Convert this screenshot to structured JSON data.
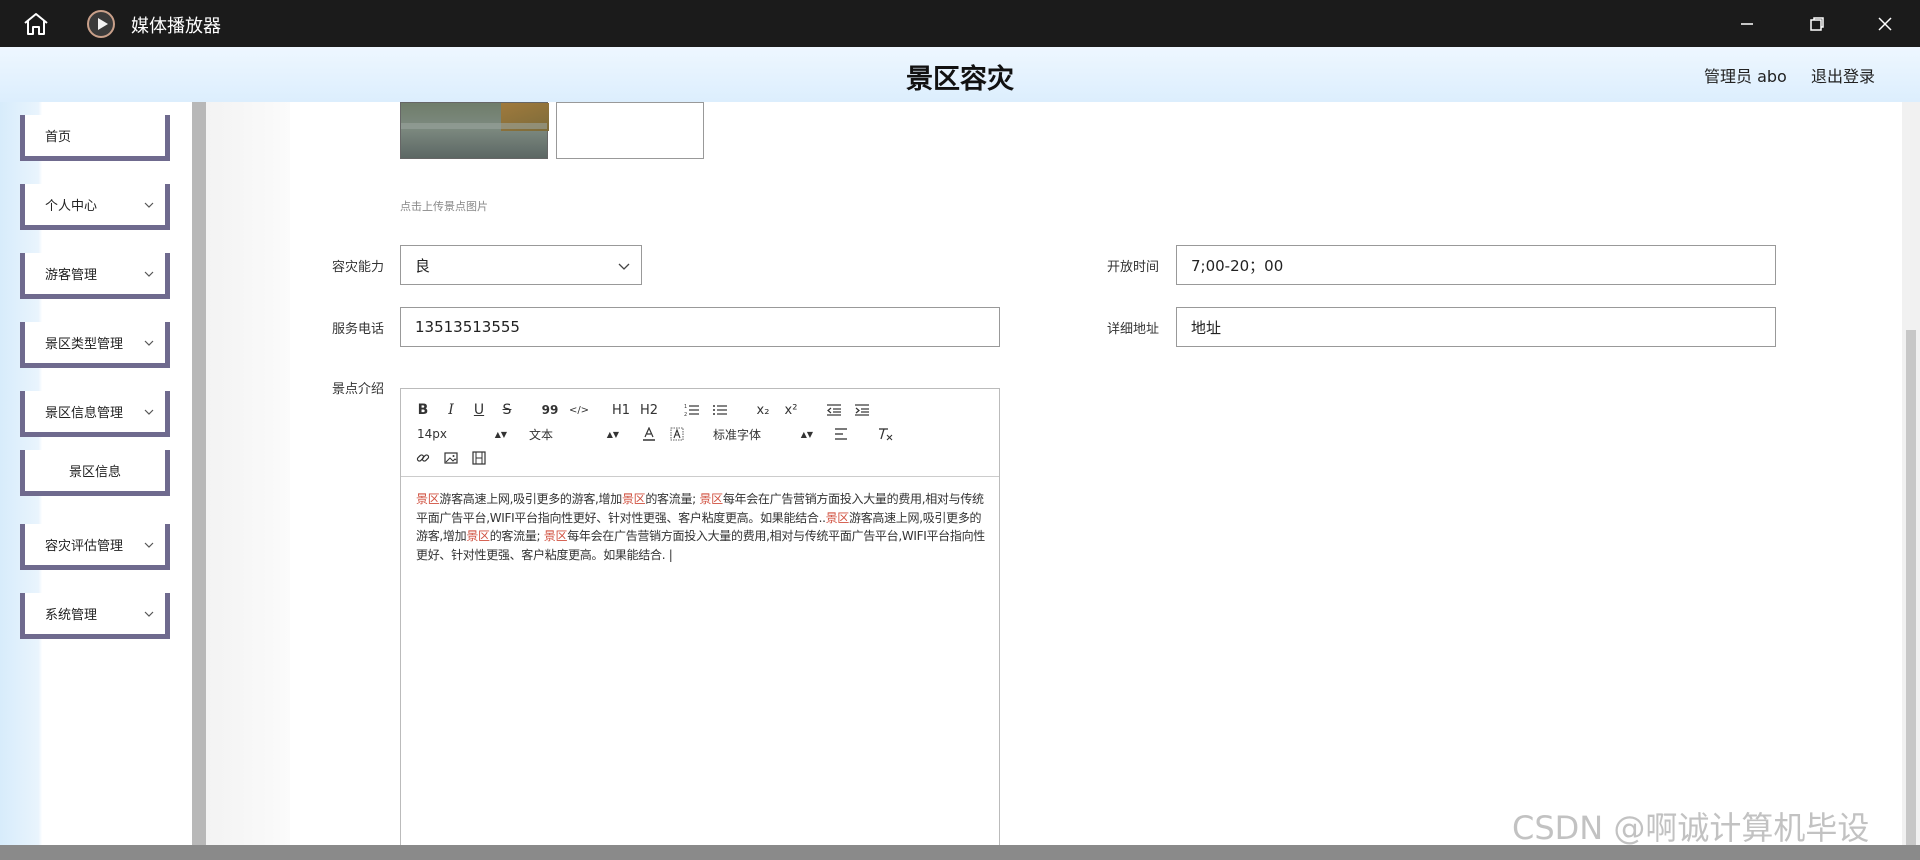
{
  "window": {
    "title": "媒体播放器"
  },
  "header": {
    "title": "景区容灾",
    "user": "管理员 abo",
    "logout": "退出登录"
  },
  "sidebar": {
    "items": [
      {
        "label": "首页"
      },
      {
        "label": "个人中心"
      },
      {
        "label": "游客管理"
      },
      {
        "label": "景区类型管理"
      },
      {
        "label": "景区信息管理"
      },
      {
        "label": "景区信息"
      },
      {
        "label": "容灾评估管理"
      },
      {
        "label": "系统管理"
      }
    ]
  },
  "form": {
    "upload_hint": "点击上传景点图片",
    "capacity_label": "容灾能力",
    "capacity_value": "良",
    "open_time_label": "开放时间",
    "open_time_value": "7;00-20；00",
    "phone_label": "服务电话",
    "phone_value": "13513513555",
    "address_label": "详细地址",
    "address_value": "地址",
    "intro_label": "景点介绍"
  },
  "editor": {
    "toolbar": {
      "bold": "B",
      "italic": "I",
      "underline": "U",
      "strike": "S",
      "quote": "99",
      "code": "</>",
      "h1": "H1",
      "h2": "H2",
      "sub": "x₂",
      "sup": "x²",
      "size": "14px",
      "block": "文本",
      "font": "标准字体"
    },
    "highlight": "景区",
    "seg1": "游客高速上网,吸引更多的游客,增加",
    "seg2": "的客流量; ",
    "seg3": "每年会在广告营销方面投入大量的费用,相对与传统平面广告平台,WIFI平台指向性更好、针对性更强、客户粘度更高。如果能结合..",
    "seg4": "游客高速上网,吸引更多的游客,增加",
    "seg5": "的客流量; ",
    "seg6": "每年会在广告营销方面投入大量的费用,相对与传统平面广告平台,WIFI平台指向性更好、针对性更强、客户粘度更高。如果能结合. |"
  },
  "watermark": "CSDN @啊诚计算机毕设"
}
